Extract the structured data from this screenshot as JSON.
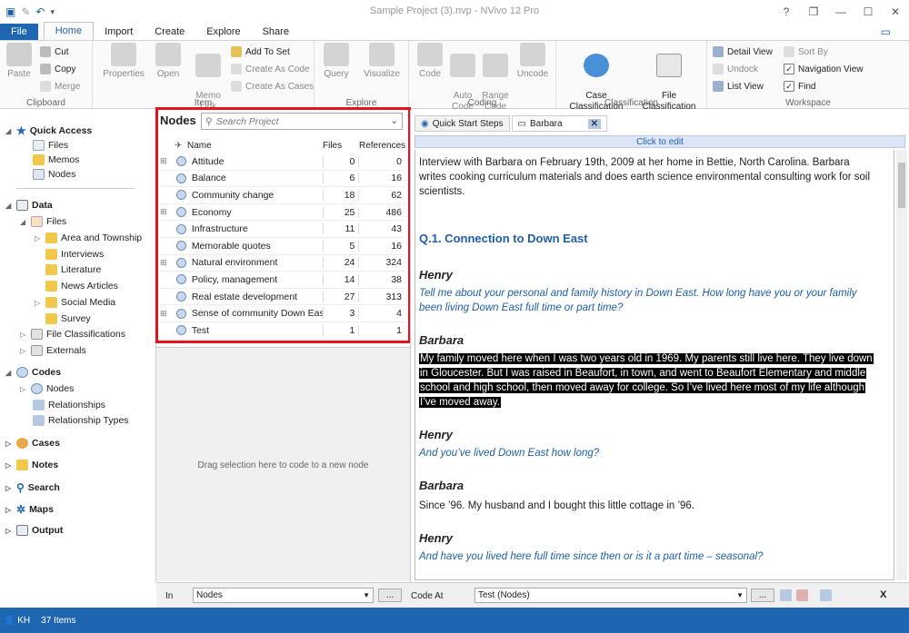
{
  "window": {
    "title": "Sample Project (3).nvp - NVivo 12 Pro",
    "help": "?",
    "restore": "❐",
    "minimize": "—",
    "maximize": "☐",
    "close": "✕"
  },
  "ribbon_tabs": [
    "File",
    "Home",
    "Import",
    "Create",
    "Explore",
    "Share"
  ],
  "ribbon": {
    "clipboard": {
      "label": "Clipboard",
      "paste": "Paste",
      "cut": "Cut",
      "copy": "Copy",
      "merge": "Merge"
    },
    "item": {
      "label": "Item",
      "properties": "Properties",
      "open": "Open",
      "memo_link": "Memo\nLink",
      "add_to_set": "Add To Set",
      "create_as_code": "Create As Code",
      "create_as_cases": "Create As Cases"
    },
    "explore": {
      "label": "Explore",
      "query": "Query",
      "visualize": "Visualize"
    },
    "coding": {
      "label": "Coding",
      "code": "Code",
      "auto_code": "Auto\nCode",
      "range_code": "Range\nCode",
      "uncode": "Uncode"
    },
    "classification": {
      "label": "Classification",
      "case": "Case\nClassification",
      "file": "File\nClassification"
    },
    "workspace": {
      "label": "Workspace",
      "detail_view": "Detail View",
      "sort_by": "Sort By",
      "undock": "Undock",
      "navigation_view": "Navigation View",
      "list_view": "List View",
      "find": "Find"
    }
  },
  "nav": {
    "quick_access": "Quick Access",
    "qa_files": "Files",
    "qa_memos": "Memos",
    "qa_nodes": "Nodes",
    "data": "Data",
    "files": "Files",
    "folders": [
      "Area and Township",
      "Interviews",
      "Literature",
      "News Articles",
      "Social Media",
      "Survey"
    ],
    "file_classifications": "File Classifications",
    "externals": "Externals",
    "codes": "Codes",
    "nodes": "Nodes",
    "relationships": "Relationships",
    "relationship_types": "Relationship Types",
    "cases": "Cases",
    "notes": "Notes",
    "search": "Search",
    "maps": "Maps",
    "output": "Output"
  },
  "nodes_panel": {
    "title": "Nodes",
    "search_placeholder": "Search Project",
    "columns": {
      "name": "Name",
      "files": "Files",
      "references": "References"
    },
    "rows": [
      {
        "name": "Attitude",
        "files": "0",
        "refs": "0",
        "expandable": true
      },
      {
        "name": "Balance",
        "files": "6",
        "refs": "16",
        "expandable": false
      },
      {
        "name": "Community change",
        "files": "18",
        "refs": "62",
        "expandable": false
      },
      {
        "name": "Economy",
        "files": "25",
        "refs": "486",
        "expandable": true
      },
      {
        "name": "Infrastructure",
        "files": "11",
        "refs": "43",
        "expandable": false
      },
      {
        "name": "Memorable quotes",
        "files": "5",
        "refs": "16",
        "expandable": false
      },
      {
        "name": "Natural environment",
        "files": "24",
        "refs": "324",
        "expandable": true
      },
      {
        "name": "Policy, management",
        "files": "14",
        "refs": "38",
        "expandable": false
      },
      {
        "name": "Real estate development",
        "files": "27",
        "refs": "313",
        "expandable": false
      },
      {
        "name": "Sense of community Down East",
        "files": "3",
        "refs": "4",
        "expandable": true
      },
      {
        "name": "Test",
        "files": "1",
        "refs": "1",
        "expandable": false
      }
    ],
    "drop_hint": "Drag selection here to code to a new node"
  },
  "doc_tabs": {
    "quick_start": "Quick Start Steps",
    "barbara": "Barbara",
    "close": "✕"
  },
  "doc": {
    "click_to_edit": "Click to edit",
    "intro": "Interview with Barbara on February 19th, 2009 at her home in Bettie, North Carolina. Barbara writes cooking curriculum materials and does earth science environmental consulting work for soil scientists.",
    "heading": "Q.1. Connection to Down East",
    "henry": "Henry",
    "barbara": "Barbara",
    "q1": "Tell me about your personal and family history in Down East. How long have you or your family been living Down East full time or part time?",
    "a1": "My family moved here when I was two years old in 1969. My parents still live here. They live down in Gloucester. But I was raised in Beaufort, in town, and went to Beaufort Elementary and middle school and high school, then moved away for college. So I’ve lived here most of my life although I’ve moved away.",
    "q2": "And you’ve lived Down East how long?",
    "a2": "Since ’96. My husband and I bought this little cottage in ’96.",
    "q3": "And have you lived here full time since then or is it a part time – seasonal?"
  },
  "coding_bar": {
    "in_label": "In",
    "in_value": "Nodes",
    "code_at_label": "Code At",
    "code_at_value": "Test (Nodes)",
    "dots": "...",
    "close": "X"
  },
  "status": {
    "user": "KH",
    "items": "37 Items"
  },
  "colors": {
    "accent": "#1e66b0",
    "highlight_box": "#e3141e",
    "link_blue": "#1e5fa8"
  }
}
